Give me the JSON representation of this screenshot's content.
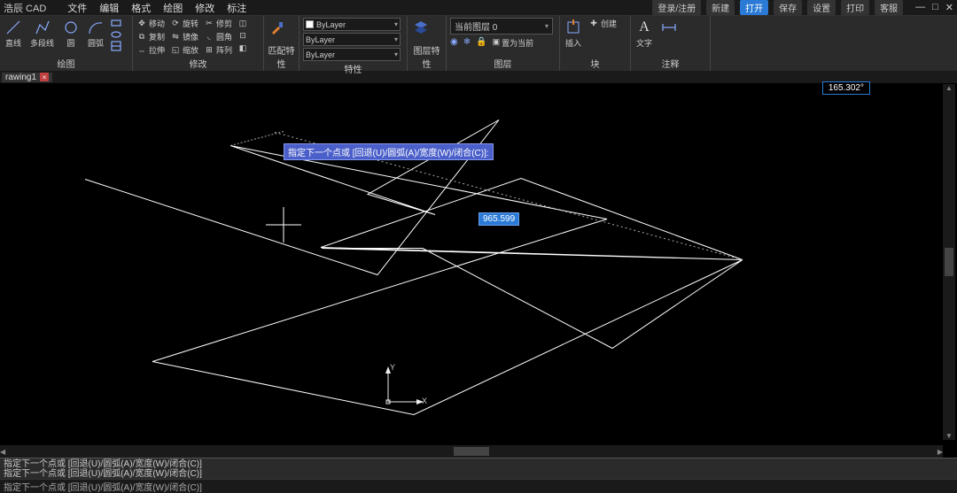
{
  "app": {
    "name": "浩辰 CAD"
  },
  "menu": [
    "文件",
    "编辑",
    "格式",
    "绘图",
    "修改",
    "标注"
  ],
  "title_actions": {
    "login": "登录/注册",
    "new": "新建",
    "open": "打开",
    "save": "保存",
    "settings": "设置",
    "print": "打印",
    "service": "客服"
  },
  "ribbon": {
    "draw": {
      "label": "绘图",
      "items": {
        "line": "直线",
        "pline": "多段线",
        "circle": "圆",
        "arc": "圆弧"
      }
    },
    "modify": {
      "label": "修改",
      "row1": {
        "move": "移动",
        "rotate": "旋转",
        "trim": "修剪"
      },
      "row2": {
        "copy": "复制",
        "mirror": "镜像",
        "fillet": "圆角"
      },
      "row3": {
        "stretch": "拉伸",
        "scale": "缩放",
        "array": "阵列"
      }
    },
    "match": {
      "label": "匹配特性"
    },
    "props": {
      "label": "特性",
      "layer_name": "ByLayer",
      "linetype": "ByLayer",
      "lineweight": "ByLayer"
    },
    "blockprops": {
      "label": "图层特性"
    },
    "layers": {
      "label": "图层",
      "current": "当前图层 0",
      "setcurrent": "置为当前"
    },
    "insert": {
      "label": "块",
      "button": "插入",
      "create": "创建"
    },
    "annot": {
      "label": "注释",
      "text": "文字"
    }
  },
  "doc": {
    "tab": "rawing1"
  },
  "canvas": {
    "cmd_prompt": "指定下一个点或 [回退(U)/圆弧(A)/宽度(W)/闭合(C)]:",
    "distance": "965.599",
    "angle": "165.302°",
    "ucs_x": "X",
    "ucs_y": "Y"
  },
  "cmd_history": [
    "指定下一个点或 [回退(U)/圆弧(A)/宽度(W)/闭合(C)]",
    "指定下一个点或 [回退(U)/圆弧(A)/宽度(W)/闭合(C)]"
  ],
  "status": {
    "prompt": "指定下一个点或 [回退(U)/圆弧(A)/宽度(W)/闭合(C)]"
  }
}
